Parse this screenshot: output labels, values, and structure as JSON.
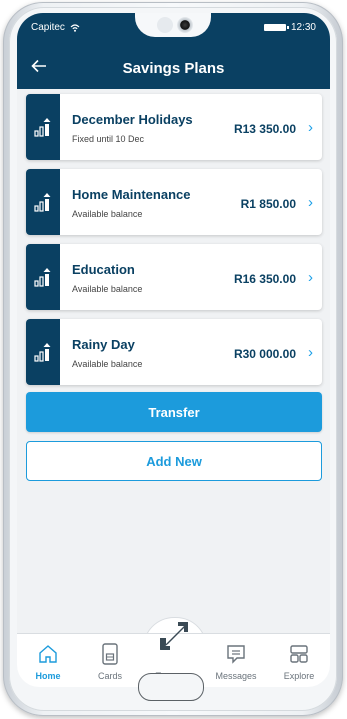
{
  "status": {
    "carrier": "Capitec",
    "time": "12:30"
  },
  "header": {
    "title": "Savings Plans"
  },
  "plans": [
    {
      "name": "December Holidays",
      "subtitle": "Fixed until 10 Dec",
      "amount": "R13 350.00"
    },
    {
      "name": "Home Maintenance",
      "subtitle": "Available balance",
      "amount": "R1 850.00"
    },
    {
      "name": "Education",
      "subtitle": "Available balance",
      "amount": "R16 350.00"
    },
    {
      "name": "Rainy Day",
      "subtitle": "Available balance",
      "amount": "R30 000.00"
    }
  ],
  "actions": {
    "transfer_label": "Transfer",
    "add_new_label": "Add New"
  },
  "nav": [
    {
      "label": "Home",
      "icon": "home-icon",
      "active": true
    },
    {
      "label": "Cards",
      "icon": "cards-icon",
      "active": false
    },
    {
      "label": "Transact",
      "icon": "transact-icon",
      "active": false
    },
    {
      "label": "Messages",
      "icon": "messages-icon",
      "active": false
    },
    {
      "label": "Explore",
      "icon": "explore-icon",
      "active": false
    }
  ],
  "colors": {
    "primary": "#0a4062",
    "accent": "#1c9bdc",
    "background": "#f0f2f4"
  }
}
